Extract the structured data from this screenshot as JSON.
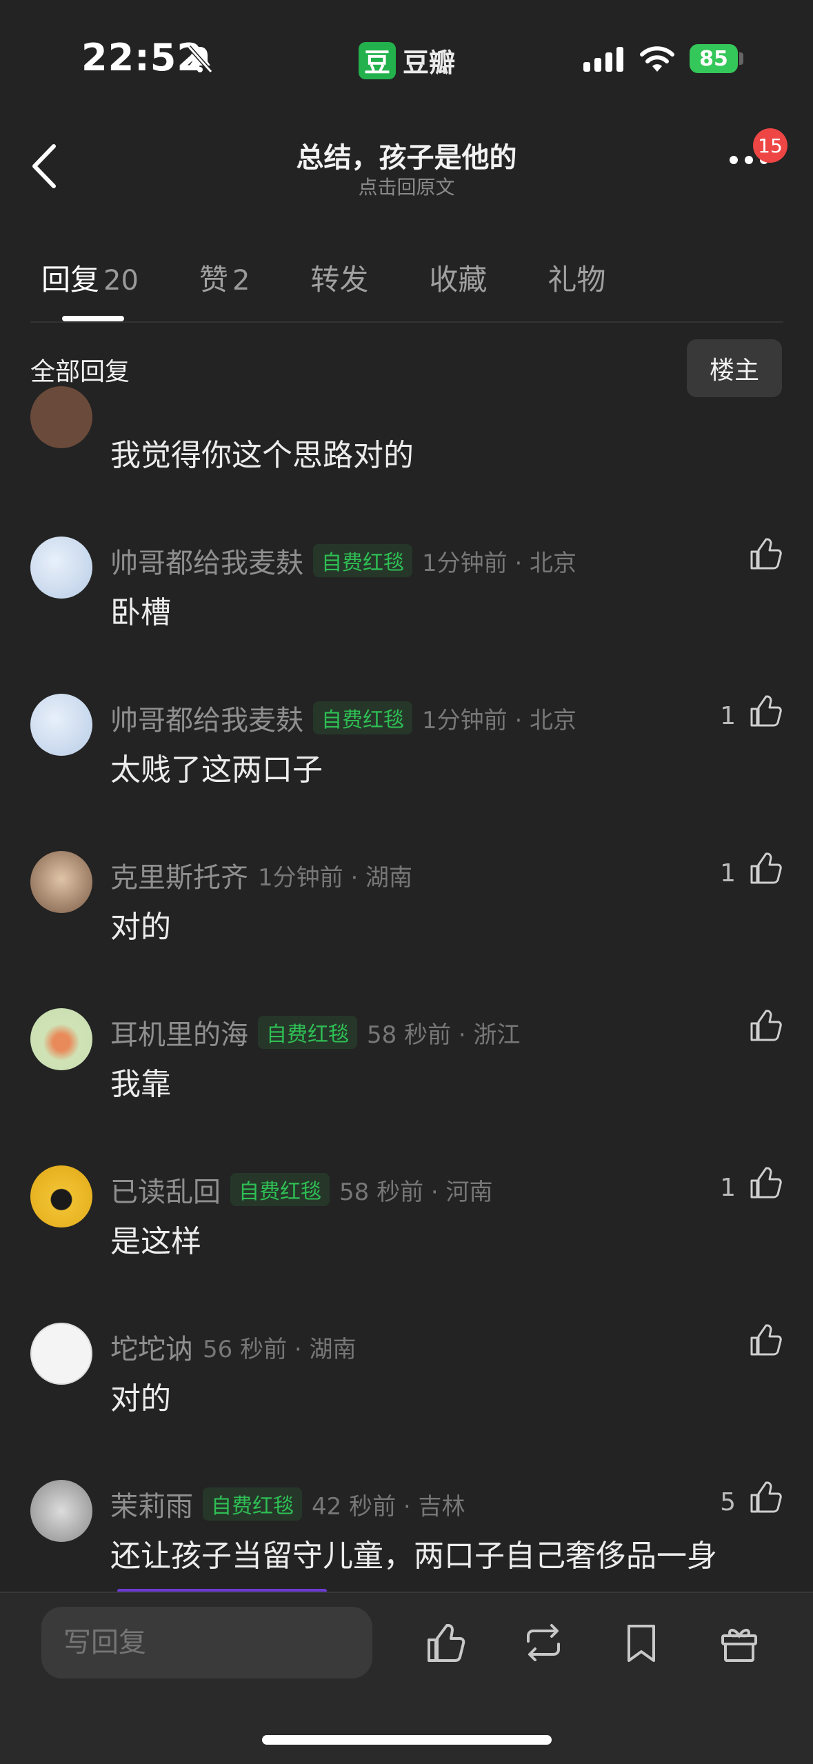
{
  "status_bar": {
    "time": "22:52",
    "app_logo": "豆",
    "app_name": "豆瓣",
    "battery": "85"
  },
  "header": {
    "title": "总结，孩子是他的",
    "subtitle": "点击回原文",
    "notification_count": "15",
    "icons": [
      "chevron-left-icon",
      "more-icon"
    ]
  },
  "tabs": [
    {
      "label": "回复",
      "count": "20",
      "active": true
    },
    {
      "label": "赞",
      "count": "2"
    },
    {
      "label": "转发",
      "count": ""
    },
    {
      "label": "收藏",
      "count": ""
    },
    {
      "label": "礼物",
      "count": ""
    }
  ],
  "section": {
    "label": "全部回复",
    "filter_button": "楼主"
  },
  "partial_comment": {
    "text": "我觉得你这个思路对的"
  },
  "comments": [
    {
      "name": "帅哥都给我麦麸",
      "tag": "自费红毯",
      "time_loc": "1分钟前 · 北京",
      "text": "卧槽",
      "likes": ""
    },
    {
      "name": "帅哥都给我麦麸",
      "tag": "自费红毯",
      "time_loc": "1分钟前 · 北京",
      "text": "太贱了这两口子",
      "likes": "1"
    },
    {
      "name": "克里斯托齐",
      "tag": "",
      "time_loc": "1分钟前 · 湖南",
      "text": "对的",
      "likes": "1"
    },
    {
      "name": "耳机里的海",
      "tag": "自费红毯",
      "time_loc": "58 秒前 · 浙江",
      "text": "我靠",
      "likes": ""
    },
    {
      "name": "已读乱回",
      "tag": "自费红毯",
      "time_loc": "58 秒前 · 河南",
      "text": "是这样",
      "likes": "1"
    },
    {
      "name": "坨坨讷",
      "tag": "",
      "time_loc": "56 秒前 · 湖南",
      "text": "对的",
      "likes": ""
    },
    {
      "name": "茉莉雨",
      "tag": "自费红毯",
      "time_loc": "42 秒前 · 吉林",
      "text": "还让孩子当留守儿童，两口子自己奢侈品一身",
      "likes": "5"
    }
  ],
  "bottom_bar": {
    "reply_placeholder": "写回复",
    "icons": [
      "thumbs-up-icon",
      "repost-icon",
      "bookmark-icon",
      "gift-icon"
    ]
  },
  "colors": {
    "background": "#232323",
    "tag_green": "#2fbf54",
    "badge_red": "#ee4545",
    "accent_purple": "#6c3bd4"
  }
}
